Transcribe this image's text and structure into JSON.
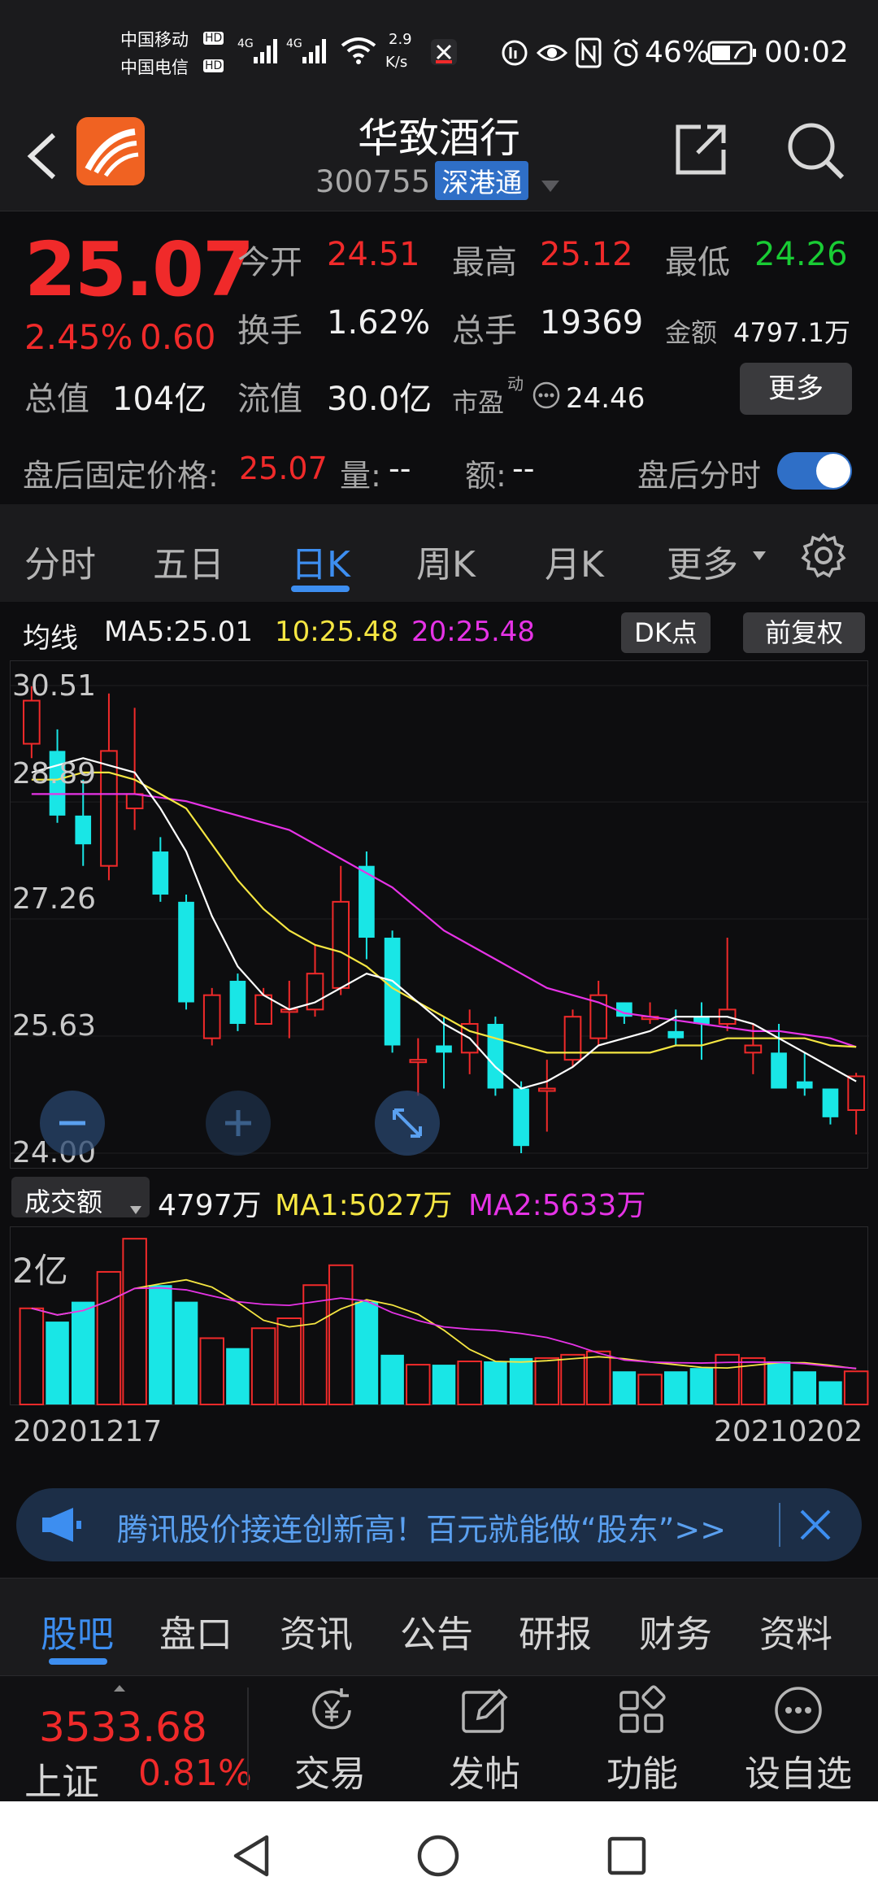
{
  "status": {
    "carrier1": "中国移动",
    "carrier2": "中国电信",
    "hd": "HD",
    "net": "4G",
    "speed_top": "2.9",
    "speed_bottom": "K/s",
    "battery": "46%",
    "time": "00:02"
  },
  "header": {
    "title": "华致酒行",
    "code": "300755",
    "tag": "深港通"
  },
  "quote": {
    "price": "25.07",
    "change_pct": "2.45%",
    "change_amt": "0.60",
    "open_label": "今开",
    "open": "24.51",
    "high_label": "最高",
    "high": "25.12",
    "low_label": "最低",
    "low": "24.26",
    "turnover_label": "换手",
    "turnover": "1.62%",
    "volume_label": "总手",
    "volume": "19369",
    "amount_label": "金额",
    "amount": "4797.1万",
    "mktcap_label": "总值",
    "mktcap": "104亿",
    "float_label": "流值",
    "float": "30.0亿",
    "pe_label": "市盈",
    "pe_sup": "动",
    "pe": "24.46",
    "more": "更多"
  },
  "afterhours": {
    "label": "盘后固定价格:",
    "price": "25.07",
    "vol_label": "量:",
    "vol": "--",
    "amt_label": "额:",
    "amt": "--",
    "toggle_label": "盘后分时",
    "toggle_on": true
  },
  "tabs": [
    "分时",
    "五日",
    "日K",
    "周K",
    "月K",
    "更多"
  ],
  "active_tab": 2,
  "ma": {
    "label": "均线",
    "ma5": "MA5:25.01",
    "ma10": "10:25.48",
    "ma20": "20:25.48",
    "dk": "DK点",
    "adjust": "前复权"
  },
  "kchart": {
    "y_labels": [
      "30.51",
      "28.89",
      "27.26",
      "25.63",
      "24.00"
    ],
    "ymin": 24.0,
    "ymax": 30.51,
    "candles": [
      {
        "o": 29.7,
        "c": 30.3,
        "h": 30.5,
        "l": 29.5
      },
      {
        "o": 29.6,
        "c": 28.7,
        "h": 29.9,
        "l": 28.6
      },
      {
        "o": 28.7,
        "c": 28.3,
        "h": 29.2,
        "l": 28.0
      },
      {
        "o": 28.0,
        "c": 29.6,
        "h": 30.4,
        "l": 27.8
      },
      {
        "o": 28.8,
        "c": 29.0,
        "h": 30.2,
        "l": 28.5
      },
      {
        "o": 28.2,
        "c": 27.6,
        "h": 28.4,
        "l": 27.5
      },
      {
        "o": 27.5,
        "c": 26.1,
        "h": 27.6,
        "l": 26.0
      },
      {
        "o": 25.6,
        "c": 26.2,
        "h": 26.3,
        "l": 25.5
      },
      {
        "o": 26.4,
        "c": 25.8,
        "h": 26.5,
        "l": 25.7
      },
      {
        "o": 25.8,
        "c": 26.2,
        "h": 26.3,
        "l": 25.8
      },
      {
        "o": 26.0,
        "c": 26.0,
        "h": 26.4,
        "l": 25.6
      },
      {
        "o": 26.0,
        "c": 26.5,
        "h": 26.9,
        "l": 25.9
      },
      {
        "o": 26.3,
        "c": 27.5,
        "h": 28.0,
        "l": 26.2
      },
      {
        "o": 28.0,
        "c": 27.0,
        "h": 28.2,
        "l": 26.7
      },
      {
        "o": 27.0,
        "c": 25.5,
        "h": 27.1,
        "l": 25.4
      },
      {
        "o": 25.3,
        "c": 25.3,
        "h": 25.6,
        "l": 24.8
      },
      {
        "o": 25.5,
        "c": 25.4,
        "h": 25.9,
        "l": 24.9
      },
      {
        "o": 25.4,
        "c": 25.8,
        "h": 26.0,
        "l": 25.1
      },
      {
        "o": 25.8,
        "c": 24.9,
        "h": 25.9,
        "l": 24.8
      },
      {
        "o": 24.9,
        "c": 24.1,
        "h": 25.0,
        "l": 24.0
      },
      {
        "o": 24.9,
        "c": 24.9,
        "h": 25.3,
        "l": 24.3
      },
      {
        "o": 25.3,
        "c": 25.9,
        "h": 26.0,
        "l": 25.2
      },
      {
        "o": 25.6,
        "c": 26.2,
        "h": 26.4,
        "l": 25.5
      },
      {
        "o": 26.1,
        "c": 25.9,
        "h": 26.1,
        "l": 25.8
      },
      {
        "o": 25.9,
        "c": 25.9,
        "h": 26.1,
        "l": 25.8
      },
      {
        "o": 25.7,
        "c": 25.6,
        "h": 26.0,
        "l": 25.5
      },
      {
        "o": 25.9,
        "c": 25.8,
        "h": 26.1,
        "l": 25.3
      },
      {
        "o": 25.8,
        "c": 26.0,
        "h": 27.0,
        "l": 25.7
      },
      {
        "o": 25.4,
        "c": 25.5,
        "h": 25.8,
        "l": 25.1
      },
      {
        "o": 25.4,
        "c": 24.9,
        "h": 25.8,
        "l": 24.9
      },
      {
        "o": 25.0,
        "c": 24.9,
        "h": 25.4,
        "l": 24.8
      },
      {
        "o": 24.9,
        "c": 24.5,
        "h": 24.9,
        "l": 24.4
      },
      {
        "o": 24.6,
        "c": 25.07,
        "h": 25.12,
        "l": 24.26
      }
    ],
    "ma5": [
      29.3,
      29.4,
      29.5,
      29.4,
      29.3,
      28.8,
      28.2,
      27.3,
      26.6,
      26.2,
      26.0,
      26.1,
      26.3,
      26.5,
      26.4,
      26.1,
      25.8,
      25.6,
      25.2,
      24.9,
      25.0,
      25.2,
      25.5,
      25.6,
      25.7,
      25.9,
      25.9,
      25.9,
      25.8,
      25.6,
      25.4,
      25.2,
      25.0
    ],
    "ma10": [
      29.2,
      29.2,
      29.3,
      29.3,
      29.2,
      29.0,
      28.8,
      28.3,
      27.8,
      27.4,
      27.1,
      26.9,
      26.8,
      26.6,
      26.3,
      26.1,
      25.9,
      25.7,
      25.6,
      25.5,
      25.4,
      25.4,
      25.4,
      25.4,
      25.4,
      25.5,
      25.5,
      25.6,
      25.6,
      25.6,
      25.6,
      25.5,
      25.48
    ],
    "ma20": [
      29.0,
      29.0,
      29.0,
      29.0,
      29.0,
      28.95,
      28.9,
      28.8,
      28.7,
      28.6,
      28.5,
      28.3,
      28.1,
      27.9,
      27.7,
      27.4,
      27.1,
      26.9,
      26.7,
      26.5,
      26.3,
      26.2,
      26.1,
      25.95,
      25.9,
      25.85,
      25.8,
      25.75,
      25.7,
      25.7,
      25.65,
      25.6,
      25.48
    ]
  },
  "vol_row": {
    "selector": "成交额",
    "value": "4797万",
    "ma1": "MA1:5027万",
    "ma2": "MA2:5633万"
  },
  "volchart": {
    "y_label": "2亿",
    "date_start": "20201217",
    "date_end": "20210202"
  },
  "ad": {
    "text": "腾讯股价接连创新高！百元就能做“股东”>>"
  },
  "bottom_tabs": [
    "股吧",
    "盘口",
    "资讯",
    "公告",
    "研报",
    "财务",
    "资料"
  ],
  "active_bottom_tab": 0,
  "index": {
    "value": "3533.68",
    "name": "上证",
    "change": "0.81%"
  },
  "actions": [
    "交易",
    "发帖",
    "功能",
    "设自选"
  ],
  "colors": {
    "up": "#f02a2a",
    "down": "#19e6e6",
    "ma5": "#ffffff",
    "ma10": "#f5e642",
    "ma20": "#e633e6",
    "accent": "#3d8ef0"
  }
}
